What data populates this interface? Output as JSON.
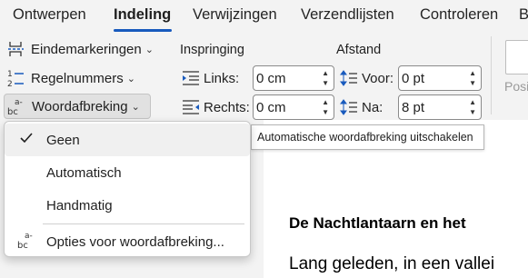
{
  "tabs": [
    "Ontwerpen",
    "Indeling",
    "Verwijzingen",
    "Verzendlijsten",
    "Controleren",
    "B"
  ],
  "ribbon": {
    "hyphenation_breaks_label": "Eindemarkeringen",
    "line_numbers_label": "Regelnummers",
    "hyphenation_label": "Woordafbreking",
    "indent_group": "Inspringing",
    "spacing_group": "Afstand",
    "indent_left_label": "Links:",
    "indent_left_value": "0 cm",
    "indent_right_label": "Rechts:",
    "indent_right_value": "0 cm",
    "spacing_before_label": "Voor:",
    "spacing_before_value": "0 pt",
    "spacing_after_label": "Na:",
    "spacing_after_value": "8 pt",
    "position_label": "Posi"
  },
  "tooltip": "Automatische woordafbreking uitschakelen",
  "menu": {
    "items": [
      {
        "label": "Geen",
        "accel": "G",
        "checked": true
      },
      {
        "label": "Automatisch",
        "accel": "A",
        "checked": false
      },
      {
        "label": "Handmatig",
        "accel": "H",
        "checked": false
      },
      {
        "label": "Opties voor woordafbreking...",
        "accel": "O",
        "checked": false
      }
    ]
  },
  "document": {
    "heading": "De Nachtlantaarn en het",
    "paragraph": "Lang geleden, in een vallei"
  },
  "icons": {
    "check": "checkmark-icon",
    "hyphenation": "hyphenation-icon",
    "line_numbers": "line-numbers-icon",
    "breaks": "breaks-icon",
    "indent_left": "indent-left-icon",
    "indent_right": "indent-right-icon",
    "spacing_before": "spacing-before-icon",
    "spacing_after": "spacing-after-icon"
  },
  "colors": {
    "accent": "#185abd",
    "ribbon_bg": "#f3f3f3",
    "menu_hover": "#f0f0f0"
  }
}
